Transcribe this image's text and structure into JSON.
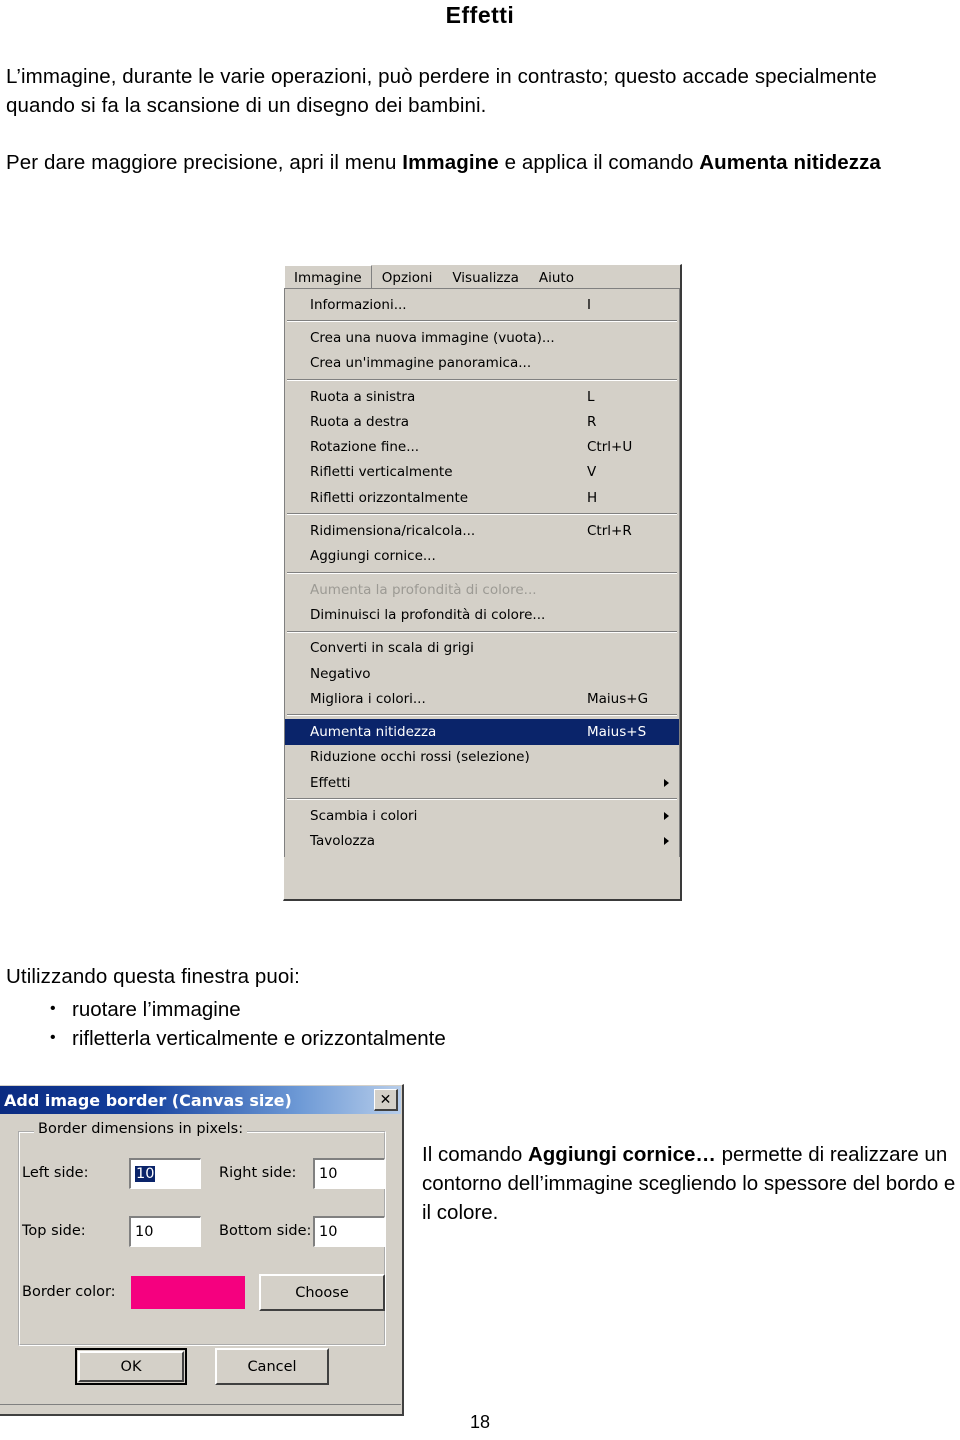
{
  "document": {
    "title": "Effetti",
    "paragraph_1": "L’immagine, durante le varie operazioni, può perdere in contrasto; questo accade specialmente quando si fa la scansione di un disegno dei bambini.",
    "paragraph_2_pre": "Per dare maggiore precisione, apri il menu ",
    "paragraph_2_bold_1": "Immagine",
    "paragraph_2_mid": " e applica il comando ",
    "paragraph_2_bold_2": "Aumenta nitidezza",
    "paragraph_3": "Utilizzando questa finestra puoi:",
    "bullets": [
      "ruotare l’immagine",
      "rifletterla verticalmente e orizzontalmente"
    ],
    "side_paragraph_pre": "Il comando ",
    "side_paragraph_bold": "Aggiungi cornice…",
    "side_paragraph_post": " permette di realizzare un contorno dell’immagine scegliendo lo spessore del bordo e il colore.",
    "page_number": "18"
  },
  "menu_screenshot": {
    "menubar": [
      {
        "label": "Immagine",
        "open": true
      },
      {
        "label": "Opzioni",
        "open": false
      },
      {
        "label": "Visualizza",
        "open": false
      },
      {
        "label": "Aiuto",
        "open": false
      }
    ],
    "items": [
      {
        "label": "Informazioni...",
        "accel": "I",
        "type": "item"
      },
      {
        "type": "separator"
      },
      {
        "label": "Crea una nuova immagine (vuota)...",
        "accel": "",
        "type": "item"
      },
      {
        "label": "Crea un'immagine panoramica...",
        "accel": "",
        "type": "item"
      },
      {
        "type": "separator"
      },
      {
        "label": "Ruota a sinistra",
        "accel": "L",
        "type": "item"
      },
      {
        "label": "Ruota a destra",
        "accel": "R",
        "type": "item"
      },
      {
        "label": "Rotazione fine...",
        "accel": "Ctrl+U",
        "type": "item"
      },
      {
        "label": "Rifletti verticalmente",
        "accel": "V",
        "type": "item"
      },
      {
        "label": "Rifletti orizzontalmente",
        "accel": "H",
        "type": "item"
      },
      {
        "type": "separator"
      },
      {
        "label": "Ridimensiona/ricalcola...",
        "accel": "Ctrl+R",
        "type": "item"
      },
      {
        "label": "Aggiungi cornice...",
        "accel": "",
        "type": "item"
      },
      {
        "type": "separator"
      },
      {
        "label": "Aumenta la profondità di colore...",
        "accel": "",
        "type": "item",
        "disabled": true
      },
      {
        "label": "Diminuisci la profondità di colore...",
        "accel": "",
        "type": "item"
      },
      {
        "type": "separator"
      },
      {
        "label": "Converti in scala di grigi",
        "accel": "",
        "type": "item"
      },
      {
        "label": "Negativo",
        "accel": "",
        "type": "item"
      },
      {
        "label": "Migliora i colori...",
        "accel": "Maius+G",
        "type": "item"
      },
      {
        "type": "separator"
      },
      {
        "label": "Aumenta nitidezza",
        "accel": "Maius+S",
        "type": "item",
        "selected": true
      },
      {
        "label": "Riduzione occhi rossi (selezione)",
        "accel": "",
        "type": "item"
      },
      {
        "label": "Effetti",
        "accel": "",
        "type": "item",
        "submenu": true
      },
      {
        "type": "separator"
      },
      {
        "label": "Scambia i colori",
        "accel": "",
        "type": "item",
        "submenu": true
      },
      {
        "label": "Tavolozza",
        "accel": "",
        "type": "item",
        "submenu": true
      }
    ],
    "colors": {
      "face": "#d4d0c8",
      "highlight": "#0a246a",
      "disabled_text": "#9c9a94"
    }
  },
  "dialog": {
    "title": "Add image border (Canvas size)",
    "close_label": "✕",
    "group_title": "Border dimensions in pixels:",
    "fields": {
      "left_label": "Left side:",
      "left_value": "10",
      "right_label": "Right side:",
      "right_value": "10",
      "top_label": "Top side:",
      "top_value": "10",
      "bottom_label": "Bottom side:",
      "bottom_value": "10"
    },
    "border_color_label": "Border color:",
    "border_color_value": "#f5007f",
    "choose_label": "Choose",
    "ok_label": "OK",
    "cancel_label": "Cancel",
    "colors": {
      "titlebar_start": "#0a2a80",
      "titlebar_end": "#b7cdea",
      "face": "#d4d0c8",
      "selection": "#0a246a"
    }
  }
}
